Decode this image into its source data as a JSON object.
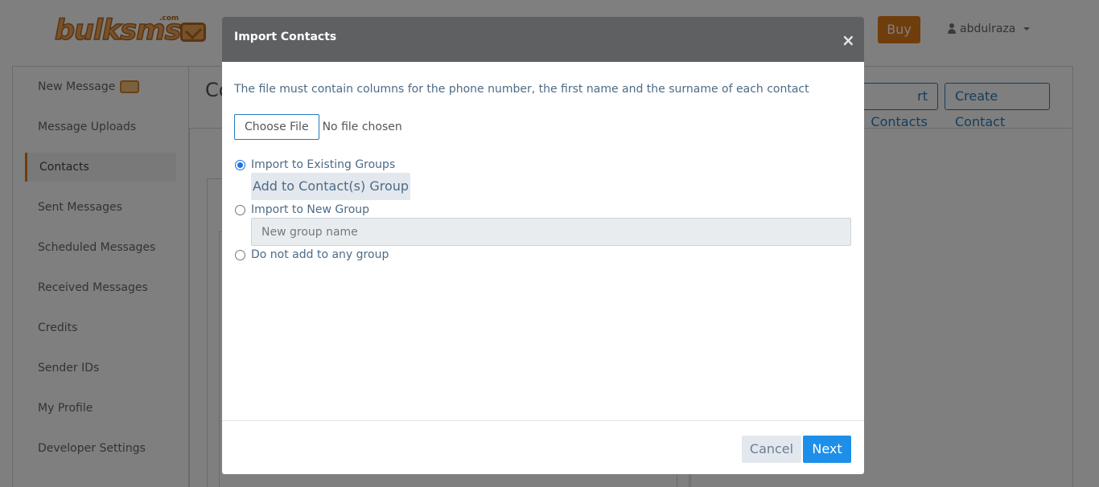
{
  "brand": {
    "logo_text": "bulksms",
    "logo_suffix": ".com"
  },
  "header": {
    "buy_label": "Buy",
    "username": "abdulraza"
  },
  "sidebar": {
    "items": [
      {
        "label": "New Message"
      },
      {
        "label": "Message Uploads"
      },
      {
        "label": "Contacts"
      },
      {
        "label": "Sent Messages"
      },
      {
        "label": "Scheduled Messages"
      },
      {
        "label": "Received Messages"
      },
      {
        "label": "Credits"
      },
      {
        "label": "Sender IDs"
      },
      {
        "label": "My Profile"
      },
      {
        "label": "Developer Settings"
      }
    ],
    "active": "Contacts"
  },
  "content": {
    "title_fragment": "Co",
    "import_button_fragment": "rt Contacts",
    "create_button": "Create Contact"
  },
  "modal": {
    "title": "Import Contacts",
    "close_glyph": "×",
    "description": "The file must contain columns for the phone number, the first name and the surname of each contact",
    "file_button": "Choose File",
    "file_status": "No file chosen",
    "options": {
      "existing": "Import to Existing Groups",
      "new": "Import to New Group",
      "none": "Do not add to any group"
    },
    "selected_option": "existing",
    "group_button": "Add to Contact(s) Group",
    "group_name_placeholder": "New group name",
    "cancel_label": "Cancel",
    "next_label": "Next"
  },
  "colors": {
    "accent": "#e07a1a",
    "primary": "#1e8fe9",
    "header": "#5f6062"
  }
}
